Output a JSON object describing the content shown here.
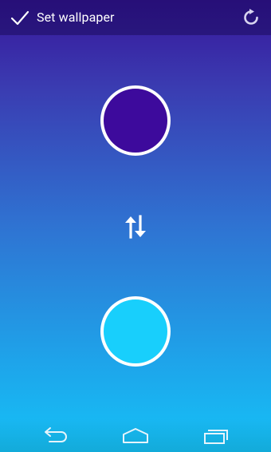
{
  "action_bar": {
    "title": "Set wallpaper",
    "confirm_icon": "checkmark-icon",
    "reset_icon": "refresh-icon"
  },
  "colors": {
    "top_color": "#3d0a9c",
    "bottom_color": "#18cffc",
    "gradient_top": "#38169a",
    "gradient_bottom": "#15c2f7"
  },
  "swap_icon": "swap-vertical-icon",
  "navigation": {
    "back_icon": "back-icon",
    "home_icon": "home-icon",
    "recents_icon": "recent-apps-icon"
  }
}
